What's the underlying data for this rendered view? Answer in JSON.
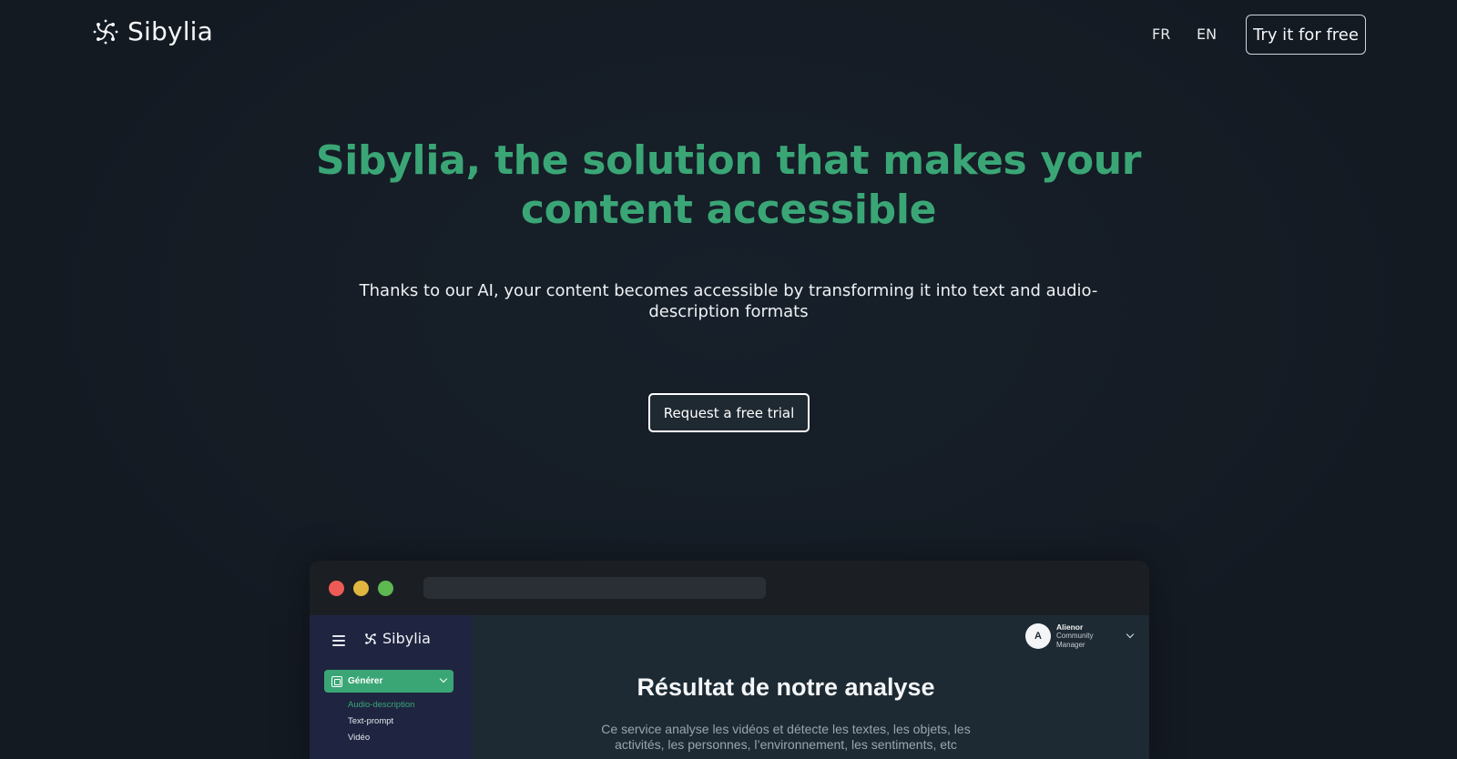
{
  "header": {
    "brand": "Sibylia",
    "logo_icon": "sibylia-logo-icon",
    "languages": [
      "FR",
      "EN"
    ],
    "try_button": "Try it for free"
  },
  "hero": {
    "title": "Sibylia, the solution that makes your content accessible",
    "subtitle": "Thanks to our AI, your content becomes accessible by transforming it into text and audio-description formats",
    "cta": "Request a free trial",
    "title_color": "#3aa676"
  },
  "mockup": {
    "window_dots": [
      "#ee5a55",
      "#dfb63f",
      "#5cb84f"
    ],
    "sidebar": {
      "brand": "Sibylia",
      "menu_icon": "hamburger-menu-icon",
      "generate_button": "Générer",
      "items": [
        {
          "label": "Audio-description",
          "active": true
        },
        {
          "label": "Text-prompt",
          "active": false
        },
        {
          "label": "Vidéo",
          "active": false
        }
      ]
    },
    "user": {
      "initial": "A",
      "name": "Alienor",
      "role": "Community Manager"
    },
    "main": {
      "title": "Résultat de notre analyse",
      "description": "Ce service analyse les vidéos et détecte les textes, les objets, les activités, les personnes, l’environnement, les sentiments, etc"
    }
  }
}
